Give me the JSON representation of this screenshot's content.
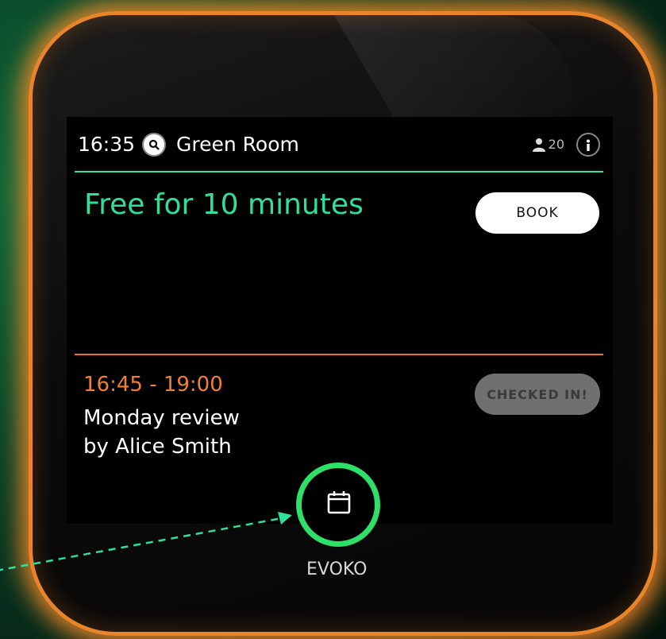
{
  "header": {
    "time": "16:35",
    "room_name": "Green Room",
    "capacity": "20"
  },
  "status": {
    "text": "Free for 10 minutes",
    "book_label": "BOOK"
  },
  "next_meeting": {
    "time_range": "16:45 - 19:00",
    "title": "Monday review",
    "organizer": "by Alice Smith",
    "checkin_label": "CHECKED IN!"
  },
  "device": {
    "brand": "EVOKO"
  },
  "icons": [
    "search-icon",
    "person-icon",
    "info-icon",
    "calendar-icon"
  ],
  "colors": {
    "accent_green": "#2ee09a",
    "accent_orange": "#e87426",
    "frame_glow": "#e8842a"
  }
}
